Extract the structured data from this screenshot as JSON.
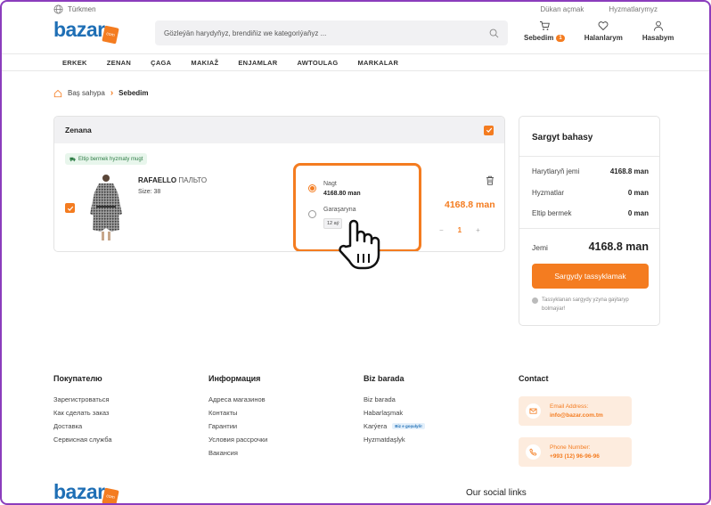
{
  "top": {
    "language": "Türkmen",
    "links": [
      "Dükan açmak",
      "Hyzmatlarymyz"
    ]
  },
  "header": {
    "logo_text": "bazar",
    "logo_badge": "com",
    "search_placeholder": "Gözleýän harydyňyz, brendiňiz we kategoriýaňyz ...",
    "cart_label": "Sebedim",
    "cart_count": "1",
    "favorites_label": "Halanlarym",
    "account_label": "Hasabym"
  },
  "nav": [
    "ERKEK",
    "ZENAN",
    "ÇAGA",
    "MAKIAŽ",
    "ENJAMLAR",
    "AWTOULAG",
    "MARKALAR"
  ],
  "breadcrumb": {
    "home": "Baş sahypa",
    "current": "Sebedim"
  },
  "cart": {
    "group_title": "Zenana",
    "shipping_tag": "Eltip bermek hyzmaty mugt",
    "item": {
      "brand": "RAFAELLO",
      "name": "ПАЛЬТО",
      "size": "Size: 38",
      "price": "4168.8 man",
      "quantity": "1"
    },
    "payment": {
      "cash_label": "Nagt",
      "cash_amount": "4168.80 man",
      "installment_label": "Garaşaryna",
      "installment_term": "12 aý"
    }
  },
  "summary": {
    "title": "Sargyt bahasy",
    "rows": [
      {
        "label": "Harytlaryň jemi",
        "value": "4168.8 man"
      },
      {
        "label": "Hyzmatlar",
        "value": "0 man"
      },
      {
        "label": "Eltip bermek",
        "value": "0 man"
      }
    ],
    "total_label": "Jemi",
    "total_value": "4168.8 man",
    "order_button": "Sargydy tassyklamak",
    "note": "Tassyklanan sargydy yzyna gaýtaryp bolmaýar!"
  },
  "footer": {
    "col1": {
      "title": "Покупателю",
      "links": [
        "Зарегистроваться",
        "Как сделать заказ",
        "Доставка",
        "Сервисная служба"
      ]
    },
    "col2": {
      "title": "Информация",
      "links": [
        "Адреса магазинов",
        "Контакты",
        "Гарантии",
        "Условия рассрочки",
        "Вакансия"
      ]
    },
    "col3": {
      "title": "Biz barada",
      "links": [
        "Biz barada",
        "Habarlaşmak",
        "Karýera",
        "Hyzmatdaşlyk"
      ],
      "career_tag": "Biz e goşulyň!"
    },
    "contact": {
      "title": "Contact",
      "email_label": "Email Address:",
      "email_value": "info@bazar.com.tm",
      "phone_label": "Phone Number:",
      "phone_value": "+993 (12) 96-96-96"
    },
    "social_title": "Our social links"
  },
  "colors": {
    "accent": "#f47c20",
    "brand": "#1f6fb5",
    "frame": "#8b3dbd"
  }
}
